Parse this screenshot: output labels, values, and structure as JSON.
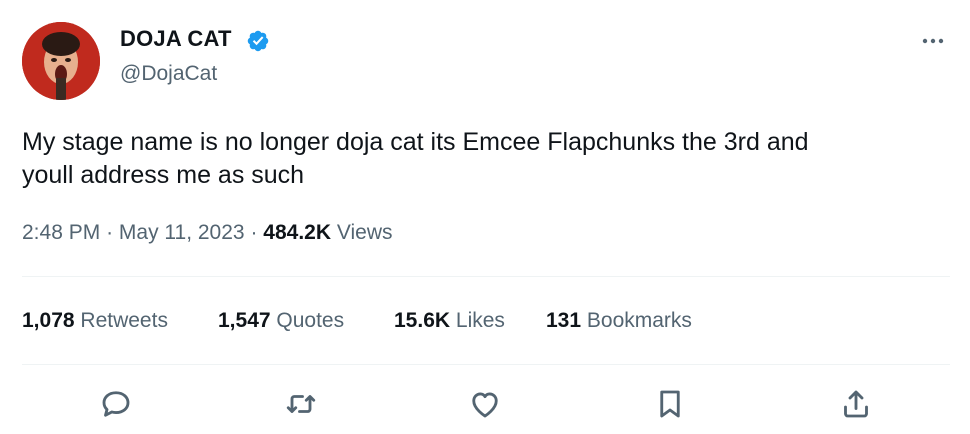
{
  "author": {
    "display_name": "DOJA CAT",
    "handle": "@DojaCat",
    "verified": true,
    "verified_color": "#1d9bf0",
    "avatar_icon": "profile-photo"
  },
  "tweet": {
    "text": "My stage name is no longer doja cat its Emcee Flapchunks the 3rd and\nyoull address me as such",
    "time": "2:48 PM",
    "sep1": "·",
    "date": "May 11, 2023",
    "sep2": "·",
    "views_count": "484.2K",
    "views_label": "Views"
  },
  "stats": {
    "retweets": {
      "count": "1,078",
      "label": "Retweets"
    },
    "quotes": {
      "count": "1,547",
      "label": "Quotes"
    },
    "likes": {
      "count": "15.6K",
      "label": "Likes"
    },
    "bookmarks": {
      "count": "131",
      "label": "Bookmarks"
    }
  },
  "actions": [
    "reply-icon",
    "retweet-icon",
    "like-icon",
    "bookmark-icon",
    "share-icon"
  ],
  "colors": {
    "text_primary": "#0f1419",
    "text_secondary": "#536471",
    "divider": "#eff3f4"
  }
}
